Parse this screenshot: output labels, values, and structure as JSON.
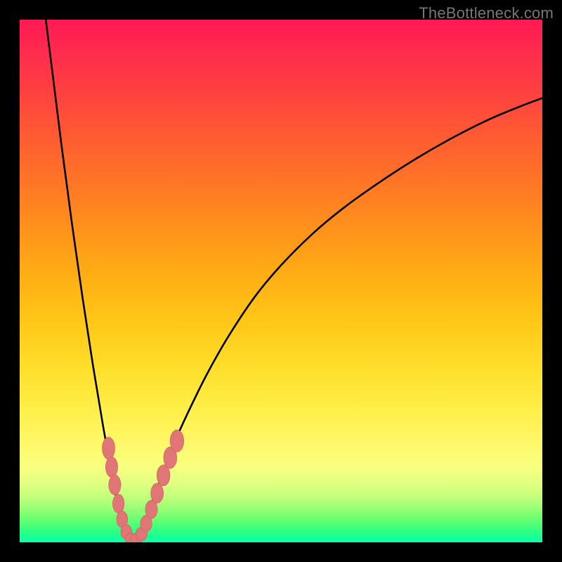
{
  "watermark": "TheBottleneck.com",
  "colors": {
    "frame": "#000000",
    "curve": "#000000",
    "marker_fill": "#e07676",
    "marker_stroke": "#d46464"
  },
  "chart_data": {
    "type": "line",
    "title": "",
    "xlabel": "",
    "ylabel": "",
    "xlim": [
      0,
      100
    ],
    "ylim": [
      0,
      100
    ],
    "grid": false,
    "legend": false,
    "series": [
      {
        "name": "left-branch",
        "x": [
          5,
          6,
          7,
          8,
          9,
          10,
          11,
          12,
          13,
          14,
          15,
          16,
          17,
          18,
          18.8,
          19.5,
          20,
          20.5,
          21,
          21.5
        ],
        "y": [
          100,
          92,
          84,
          76,
          68.5,
          61,
          54,
          47,
          40.5,
          34,
          28,
          22,
          16.5,
          11,
          7,
          4,
          2.3,
          1.2,
          0.5,
          0.1
        ]
      },
      {
        "name": "right-branch",
        "x": [
          21.5,
          22,
          22.7,
          23.5,
          24.5,
          26,
          28,
          30,
          33,
          36,
          40,
          45,
          50,
          56,
          62,
          69,
          76,
          83,
          90,
          96,
          100
        ],
        "y": [
          0.1,
          0.5,
          1.5,
          3,
          5.5,
          9.5,
          15,
          20,
          26.5,
          32.5,
          39.5,
          47,
          53,
          59,
          64,
          69,
          73.5,
          77.5,
          81,
          83.5,
          85
        ]
      }
    ],
    "markers": [
      {
        "x": 17.0,
        "y": 18.0,
        "rx": 1.2,
        "ry": 2.1
      },
      {
        "x": 17.6,
        "y": 14.4,
        "rx": 1.15,
        "ry": 1.95
      },
      {
        "x": 18.2,
        "y": 11.0,
        "rx": 1.15,
        "ry": 1.9
      },
      {
        "x": 18.9,
        "y": 7.4,
        "rx": 1.1,
        "ry": 1.8
      },
      {
        "x": 19.6,
        "y": 4.4,
        "rx": 1.05,
        "ry": 1.6
      },
      {
        "x": 20.4,
        "y": 2.0,
        "rx": 1.05,
        "ry": 1.4
      },
      {
        "x": 21.3,
        "y": 0.6,
        "rx": 1.1,
        "ry": 1.15
      },
      {
        "x": 22.3,
        "y": 0.6,
        "rx": 1.1,
        "ry": 1.15
      },
      {
        "x": 23.3,
        "y": 1.6,
        "rx": 1.1,
        "ry": 1.3
      },
      {
        "x": 24.2,
        "y": 3.6,
        "rx": 1.1,
        "ry": 1.55
      },
      {
        "x": 25.2,
        "y": 6.3,
        "rx": 1.15,
        "ry": 1.75
      },
      {
        "x": 26.3,
        "y": 9.4,
        "rx": 1.2,
        "ry": 1.9
      },
      {
        "x": 27.5,
        "y": 12.8,
        "rx": 1.25,
        "ry": 2.0
      },
      {
        "x": 28.8,
        "y": 16.2,
        "rx": 1.25,
        "ry": 2.05
      },
      {
        "x": 30.1,
        "y": 19.4,
        "rx": 1.3,
        "ry": 2.1
      }
    ]
  }
}
